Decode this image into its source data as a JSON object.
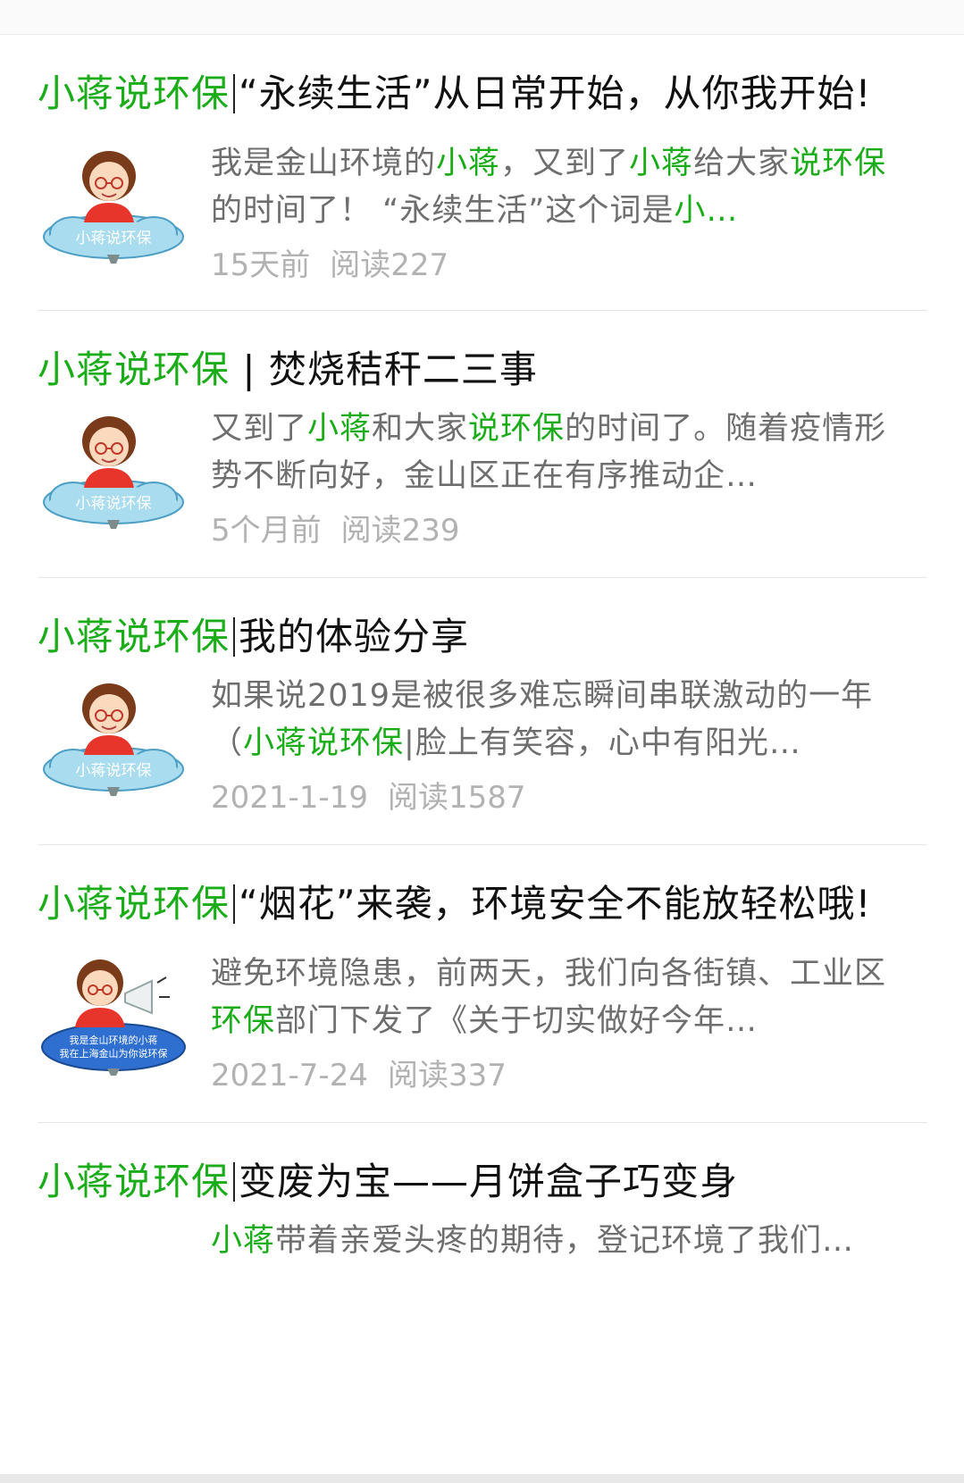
{
  "results": [
    {
      "title_parts": [
        {
          "text": "小蒋说环保",
          "hl": true
        },
        {
          "sep": true
        },
        {
          "text": "“永续生活”从日常开始，从你我开始!",
          "hl": false
        }
      ],
      "summary_parts": [
        {
          "text": "我是金山环境的",
          "hl": false
        },
        {
          "text": "小蒋",
          "hl": true
        },
        {
          "text": "，又到了",
          "hl": false
        },
        {
          "text": "小蒋",
          "hl": true
        },
        {
          "text": "给大家",
          "hl": false
        },
        {
          "text": "说环保",
          "hl": true
        },
        {
          "text": "的时间了！ “永续生活”这个词是",
          "hl": false
        },
        {
          "text": "小…",
          "hl": true
        }
      ],
      "time": "15天前",
      "reads": "阅读227",
      "thumb_text": "小蒋说环保"
    },
    {
      "title_parts": [
        {
          "text": "小蒋说环保",
          "hl": true
        },
        {
          "text": " | 焚烧秸秆二三事",
          "hl": false
        }
      ],
      "summary_parts": [
        {
          "text": "又到了",
          "hl": false
        },
        {
          "text": "小蒋",
          "hl": true
        },
        {
          "text": "和大家",
          "hl": false
        },
        {
          "text": "说环保",
          "hl": true
        },
        {
          "text": "的时间了。随着疫情形势不断向好，金山区正在有序推动企…",
          "hl": false
        }
      ],
      "time": "5个月前",
      "reads": "阅读239",
      "thumb_text": "小蒋说环保"
    },
    {
      "title_parts": [
        {
          "text": "小蒋说环保",
          "hl": true
        },
        {
          "sep": true
        },
        {
          "text": "我的体验分享",
          "hl": false
        }
      ],
      "summary_parts": [
        {
          "text": "如果说2019是被很多难忘瞬间串联激动的一年（",
          "hl": false
        },
        {
          "text": "小蒋说环保",
          "hl": true
        },
        {
          "text": "|脸上有笑容，心中有阳光…",
          "hl": false
        }
      ],
      "time": "2021-1-19",
      "reads": "阅读1587",
      "thumb_text": "小蒋说环保"
    },
    {
      "title_parts": [
        {
          "text": "小蒋说环保",
          "hl": true
        },
        {
          "sep": true
        },
        {
          "text": "“烟花”来袭，环境安全不能放轻松哦!",
          "hl": false
        }
      ],
      "summary_parts": [
        {
          "text": "避免环境隐患，前两天，我们向各街镇、工业区",
          "hl": false
        },
        {
          "text": "环保",
          "hl": true
        },
        {
          "text": "部门下发了《关于切实做好今年…",
          "hl": false
        }
      ],
      "time": "2021-7-24",
      "reads": "阅读337",
      "thumb_text_line1": "我是金山环境的小蒋",
      "thumb_text_line2": "我在上海金山为你说环保"
    },
    {
      "title_parts": [
        {
          "text": "小蒋说环保",
          "hl": true
        },
        {
          "sep": true
        },
        {
          "text": "变废为宝——月饼盒子巧变身",
          "hl": false
        }
      ],
      "summary_parts": [
        {
          "text": "小蒋",
          "hl": true
        },
        {
          "text": "带着亲爱头疼的期待，登记环境了我们…",
          "hl": false
        }
      ]
    }
  ],
  "colors": {
    "highlight": "#1aad19",
    "title": "#111111",
    "summary": "#6e6e6e",
    "meta": "#b2b2b2"
  }
}
